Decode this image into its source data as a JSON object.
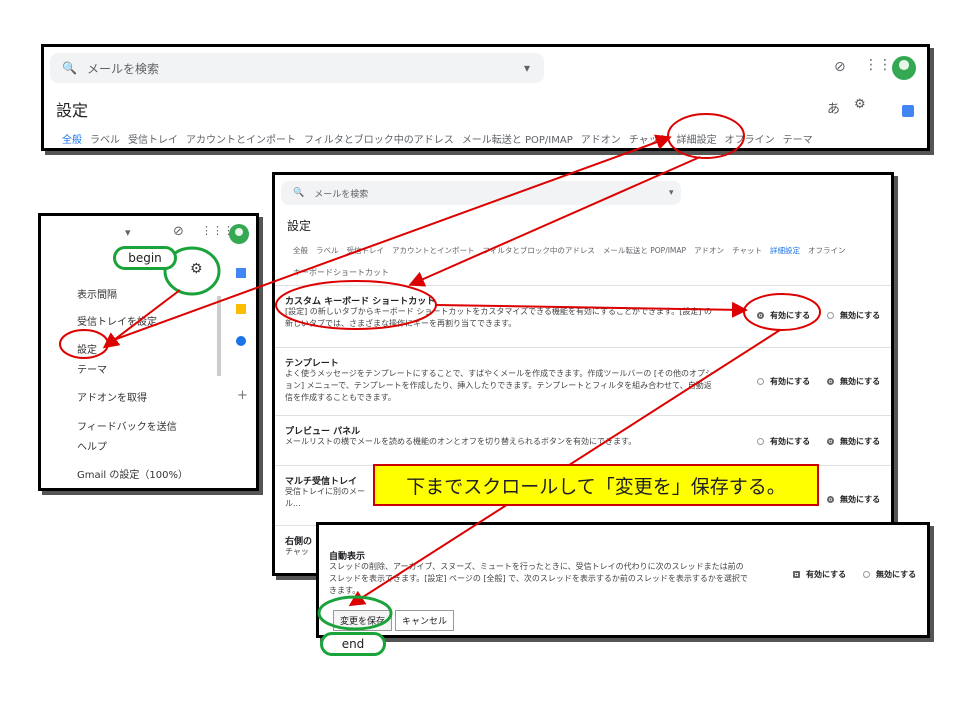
{
  "colors": {
    "accent": "#1a73e8",
    "annotation_red": "#dd0000",
    "annotation_green": "#1aa33a",
    "callout_bg": "#ffff00"
  },
  "top_panel": {
    "search_placeholder": "メールを検索",
    "title": "設定",
    "lang_label": "あ",
    "tabs": [
      "全般",
      "ラベル",
      "受信トレイ",
      "アカウントとインポート",
      "フィルタとブロック中のアドレス",
      "メール転送と POP/IMAP",
      "アドオン",
      "チャット",
      "詳細設定",
      "オフライン",
      "テーマ"
    ]
  },
  "menu_panel": {
    "items": [
      "表示間隔",
      "受信トレイを設定",
      "設定",
      "テーマ",
      "アドオンを取得",
      "フィードバックを送信",
      "ヘルプ",
      "Gmail の設定（100%）"
    ]
  },
  "mid_panel": {
    "search_placeholder": "メールを検索",
    "title": "設定",
    "tabs": [
      "全般",
      "ラベル",
      "受信トレイ",
      "アカウントとインポート",
      "フィルタとブロック中のアドレス",
      "メール転送と POP/IMAP",
      "アドオン",
      "チャット",
      "詳細設定",
      "オフライン"
    ],
    "subtab": "キーボードショートカット",
    "enable_label": "有効にする",
    "disable_label": "無効にする",
    "rows": [
      {
        "title": "カスタム キーボード ショートカット",
        "desc": "[設定] の新しいタブからキーボード ショートカットをカスタマイズできる機能を有効にすることができます。[設定] の新しいタブでは、さまざまな操作にキーを再割り当てできます。",
        "enabled": true
      },
      {
        "title": "テンプレート",
        "desc": "よく使うメッセージをテンプレートにすることで、すばやくメールを作成できます。作成ツールバーの [その他のオプション] メニューで、テンプレートを作成したり、挿入したりできます。テンプレートとフィルタを組み合わせて、自動返信を作成することもできます。",
        "enabled": false
      },
      {
        "title": "プレビュー パネル",
        "desc": "メールリストの横でメールを読める機能のオンとオフを切り替えられるボタンを有効にできます。",
        "enabled": false
      },
      {
        "title": "マルチ受信トレイ",
        "desc": "受信トレイに別のメール...",
        "enabled": false
      },
      {
        "title": "右側の",
        "desc": "チャッ",
        "enabled": false
      }
    ]
  },
  "bottom_panel": {
    "title": "自動表示",
    "desc": "スレッドの削除、アーカイブ、スヌーズ、ミュートを行ったときに、受信トレイの代わりに次のスレッドまたは前のスレッドを表示できます。[設定] ページの [全般] で、次のスレッドを表示するか前のスレッドを表示するかを選択できます。",
    "enable_label": "有効にする",
    "disable_label": "無効にする",
    "save_label": "変更を保存",
    "cancel_label": "キャンセル"
  },
  "annotations": {
    "begin": "begin",
    "end": "end",
    "callout": "下までスクロールして「変更を」保存する。"
  }
}
